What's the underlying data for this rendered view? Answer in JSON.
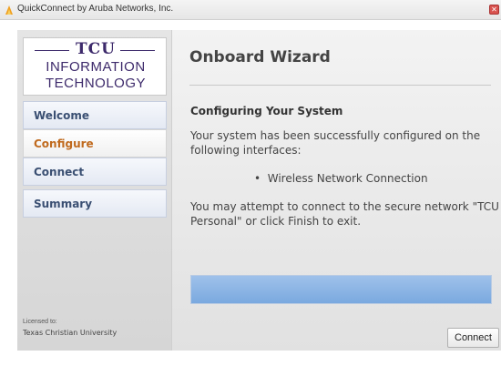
{
  "window": {
    "title": "QuickConnect by Aruba Networks, Inc.",
    "app_icon": "aruba-flame-icon",
    "close_icon": "close-icon",
    "close_glyph": "✕"
  },
  "sidebar": {
    "logo": {
      "brand": "TCU",
      "line1": "INFORMATION",
      "line2": "TECHNOLOGY"
    },
    "items": [
      {
        "label": "Welcome",
        "active": false
      },
      {
        "label": "Configure",
        "active": true
      },
      {
        "label": "Connect",
        "active": false
      },
      {
        "label": "Summary",
        "active": false
      }
    ],
    "licensed_label": "Licensed to:",
    "licensed_value": "Texas Christian University"
  },
  "main": {
    "title": "Onboard Wizard",
    "section_heading": "Configuring Your System",
    "paragraph1": "Your system has been successfully configured on the following interfaces:",
    "interfaces": [
      "Wireless Network Connection"
    ],
    "paragraph2": "You may attempt to connect to the secure network \"TCU Personal\" or click Finish to exit.",
    "progress": 1.0,
    "connect_button": "Connect"
  },
  "colors": {
    "accent_active": "#c06a1e",
    "nav_text": "#3a4f72",
    "logo_purple": "#3d2a6b",
    "progress": "#8fb6e6"
  }
}
